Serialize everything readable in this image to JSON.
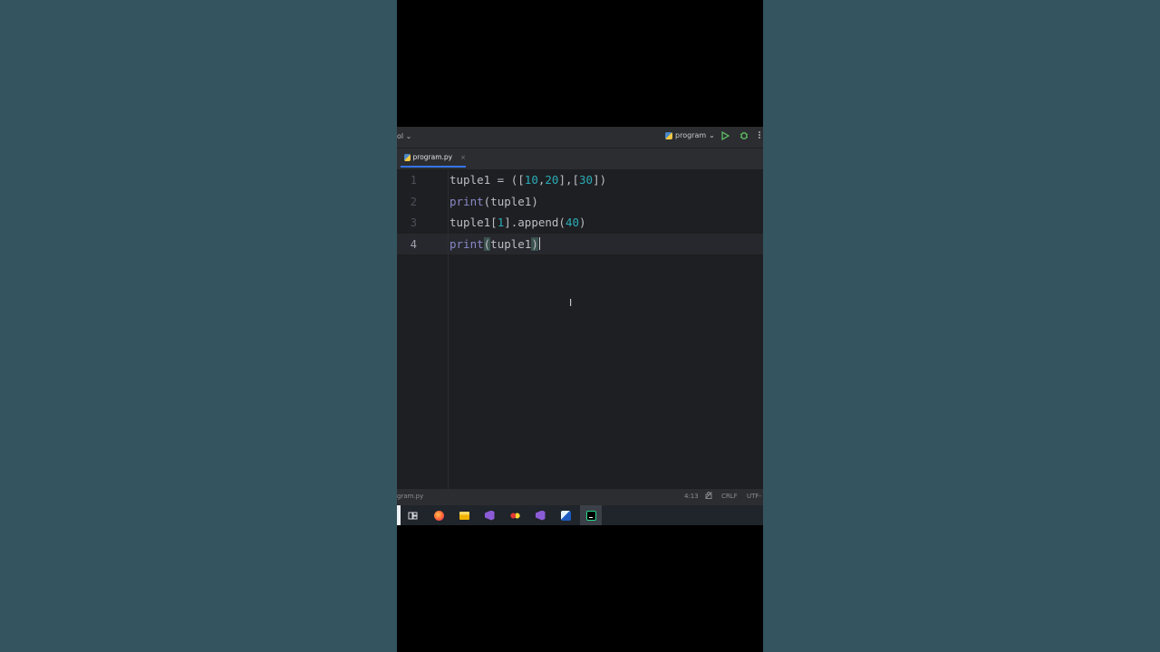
{
  "toolbar": {
    "project_label": "ol ⌄",
    "run_config": "program",
    "run_config_chevron": "⌄",
    "run_icon": "run-icon",
    "debug_icon": "debug-icon",
    "more_icon": "more-icon"
  },
  "tabs": [
    {
      "label": "program.py",
      "close": "×",
      "active": true
    }
  ],
  "editor": {
    "line_numbers": [
      "1",
      "2",
      "3",
      "4"
    ],
    "current_line": 4,
    "lines": [
      "tuple1 = ([10,20],[30])",
      "print(tuple1)",
      "tuple1[1].append(40)",
      "print(tuple1)"
    ]
  },
  "code_tokens": {
    "l1_a": "tuple1 = ([",
    "l1_n1": "10",
    "l1_c": ",",
    "l1_n2": "20",
    "l1_b": "],[",
    "l1_n3": "30",
    "l1_d": "])",
    "l2_kw": "print",
    "l2_rest": "(tuple1)",
    "l3_a": "tuple1[",
    "l3_n1": "1",
    "l3_b": "].append(",
    "l3_n2": "40",
    "l3_c": ")",
    "l4_kw": "print",
    "l4_open": "(",
    "l4_mid": "tuple1",
    "l4_close": ")"
  },
  "mouse_cursor": "I",
  "statusbar": {
    "file": "gram.py",
    "position": "4:13",
    "line_ending": "CRLF",
    "encoding": "UTF-"
  },
  "taskbar": {
    "items": [
      "task-view-icon",
      "firefox-icon",
      "file-explorer-icon",
      "visual-studio-icon",
      "app-icon",
      "visual-studio-icon",
      "app-icon",
      "pycharm-icon"
    ]
  },
  "colors": {
    "background": "#34555f",
    "editor_bg": "#1e1f22",
    "number": "#2aacb8",
    "keyword": "#8888c6",
    "accent": "#3574f0"
  }
}
